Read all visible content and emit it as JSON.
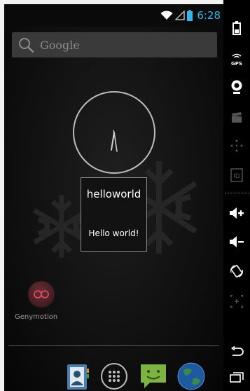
{
  "status_bar": {
    "time": "6:28",
    "wifi_icon": "wifi-icon",
    "signal_icon": "signal-icon",
    "battery_icon": "battery-icon",
    "accent_color": "#33b5e5"
  },
  "search": {
    "placeholder": "Google",
    "icon": "search-icon"
  },
  "clock": {
    "type": "analog-clock"
  },
  "toast": {
    "title": "helloworld",
    "message": "Hello world!"
  },
  "apps": [
    {
      "label": "Genymotion",
      "icon": "genymotion-icon"
    }
  ],
  "dock": {
    "items": [
      {
        "name": "contacts",
        "icon": "contacts-icon"
      },
      {
        "name": "all-apps",
        "icon": "apps-grid-icon"
      },
      {
        "name": "messaging",
        "icon": "messaging-icon"
      },
      {
        "name": "browser",
        "icon": "globe-icon"
      }
    ]
  },
  "side_panel": {
    "buttons": [
      {
        "name": "battery",
        "icon": "battery-icon"
      },
      {
        "name": "gps",
        "icon": "gps-icon",
        "label": "GPS"
      },
      {
        "name": "camera",
        "icon": "webcam-icon"
      },
      {
        "name": "video",
        "icon": "clapper-icon"
      },
      {
        "name": "dpad",
        "icon": "dpad-icon"
      },
      {
        "name": "device-id",
        "icon": "id-icon",
        "label": "ID"
      },
      {
        "name": "volume-up",
        "icon": "volume-up-icon"
      },
      {
        "name": "volume-down",
        "icon": "volume-down-icon"
      },
      {
        "name": "rotate",
        "icon": "rotate-icon"
      },
      {
        "name": "scale",
        "icon": "scale-icon"
      },
      {
        "name": "back",
        "icon": "back-icon"
      },
      {
        "name": "recent-apps",
        "icon": "recent-apps-icon"
      }
    ]
  }
}
